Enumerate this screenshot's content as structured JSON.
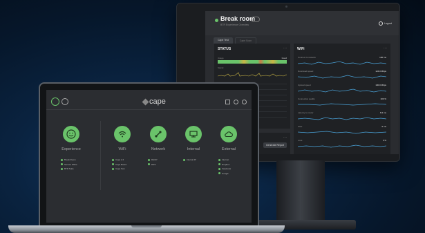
{
  "monitor": {
    "title": "Break room",
    "subtitle": "BTR Experience Overview",
    "logout_label": "Logout",
    "tabs": [
      "Cape Test",
      "Cape Scan"
    ],
    "status_panel": {
      "title": "STATUS",
      "usage_label": "Usage",
      "usage_value": "Good",
      "signal_label": "Signal"
    },
    "lower_panel": {
      "button_label": "Generate Report"
    },
    "wifi_panel": {
      "title": "WiFi",
      "rows": [
        {
          "label": "Connect to network",
          "value": "100 ms"
        },
        {
          "label": "Download speed",
          "value": "124.0 Mbps"
        },
        {
          "label": "Upload speed",
          "value": "100.0 Mbps"
        },
        {
          "label": "Connection quality",
          "value": "100 %"
        },
        {
          "label": "Latency to router",
          "value": "8.2 ms"
        },
        {
          "label": "Jitter",
          "value": "0 ms"
        },
        {
          "label": "Loss",
          "value": "0 %"
        }
      ]
    }
  },
  "laptop": {
    "brand": "cape",
    "categories": [
      {
        "name": "Experience",
        "icon": "smiley-icon",
        "items": [
          "Break Room",
          "Service Office",
          "BTR Suite"
        ]
      },
      {
        "name": "WiFi",
        "icon": "wifi-icon",
        "items": [
          "Cape 2.4",
          "Cape Board",
          "Cape Test"
        ]
      },
      {
        "name": "Network",
        "icon": "network-icon",
        "items": [
          "DHCP",
          "DNS"
        ]
      },
      {
        "name": "Internal",
        "icon": "monitor-icon",
        "items": [
          "Internal IP"
        ]
      },
      {
        "name": "External",
        "icon": "cloud-icon",
        "items": [
          "Internet",
          "Dropbox",
          "Facebook",
          "Google"
        ]
      }
    ]
  },
  "colors": {
    "accent": "#6ac36a",
    "bar_warn": "#c9b545",
    "bar_alert": "#c97a45",
    "background": "#0a2340"
  }
}
